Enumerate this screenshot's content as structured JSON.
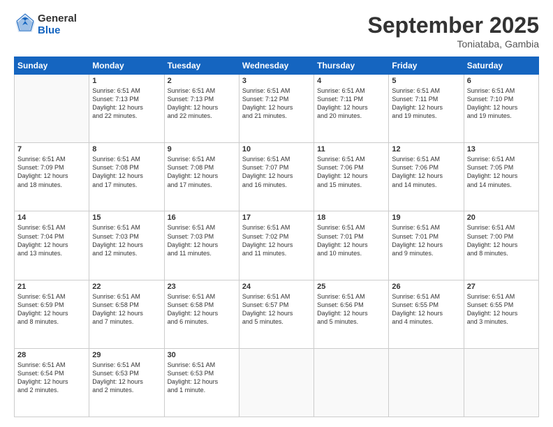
{
  "header": {
    "logo_line1": "General",
    "logo_line2": "Blue",
    "title": "September 2025",
    "subtitle": "Toniataba, Gambia"
  },
  "weekdays": [
    "Sunday",
    "Monday",
    "Tuesday",
    "Wednesday",
    "Thursday",
    "Friday",
    "Saturday"
  ],
  "weeks": [
    [
      {
        "day": "",
        "info": ""
      },
      {
        "day": "1",
        "info": "Sunrise: 6:51 AM\nSunset: 7:13 PM\nDaylight: 12 hours\nand 22 minutes."
      },
      {
        "day": "2",
        "info": "Sunrise: 6:51 AM\nSunset: 7:13 PM\nDaylight: 12 hours\nand 22 minutes."
      },
      {
        "day": "3",
        "info": "Sunrise: 6:51 AM\nSunset: 7:12 PM\nDaylight: 12 hours\nand 21 minutes."
      },
      {
        "day": "4",
        "info": "Sunrise: 6:51 AM\nSunset: 7:11 PM\nDaylight: 12 hours\nand 20 minutes."
      },
      {
        "day": "5",
        "info": "Sunrise: 6:51 AM\nSunset: 7:11 PM\nDaylight: 12 hours\nand 19 minutes."
      },
      {
        "day": "6",
        "info": "Sunrise: 6:51 AM\nSunset: 7:10 PM\nDaylight: 12 hours\nand 19 minutes."
      }
    ],
    [
      {
        "day": "7",
        "info": "Sunrise: 6:51 AM\nSunset: 7:09 PM\nDaylight: 12 hours\nand 18 minutes."
      },
      {
        "day": "8",
        "info": "Sunrise: 6:51 AM\nSunset: 7:08 PM\nDaylight: 12 hours\nand 17 minutes."
      },
      {
        "day": "9",
        "info": "Sunrise: 6:51 AM\nSunset: 7:08 PM\nDaylight: 12 hours\nand 17 minutes."
      },
      {
        "day": "10",
        "info": "Sunrise: 6:51 AM\nSunset: 7:07 PM\nDaylight: 12 hours\nand 16 minutes."
      },
      {
        "day": "11",
        "info": "Sunrise: 6:51 AM\nSunset: 7:06 PM\nDaylight: 12 hours\nand 15 minutes."
      },
      {
        "day": "12",
        "info": "Sunrise: 6:51 AM\nSunset: 7:06 PM\nDaylight: 12 hours\nand 14 minutes."
      },
      {
        "day": "13",
        "info": "Sunrise: 6:51 AM\nSunset: 7:05 PM\nDaylight: 12 hours\nand 14 minutes."
      }
    ],
    [
      {
        "day": "14",
        "info": "Sunrise: 6:51 AM\nSunset: 7:04 PM\nDaylight: 12 hours\nand 13 minutes."
      },
      {
        "day": "15",
        "info": "Sunrise: 6:51 AM\nSunset: 7:03 PM\nDaylight: 12 hours\nand 12 minutes."
      },
      {
        "day": "16",
        "info": "Sunrise: 6:51 AM\nSunset: 7:03 PM\nDaylight: 12 hours\nand 11 minutes."
      },
      {
        "day": "17",
        "info": "Sunrise: 6:51 AM\nSunset: 7:02 PM\nDaylight: 12 hours\nand 11 minutes."
      },
      {
        "day": "18",
        "info": "Sunrise: 6:51 AM\nSunset: 7:01 PM\nDaylight: 12 hours\nand 10 minutes."
      },
      {
        "day": "19",
        "info": "Sunrise: 6:51 AM\nSunset: 7:01 PM\nDaylight: 12 hours\nand 9 minutes."
      },
      {
        "day": "20",
        "info": "Sunrise: 6:51 AM\nSunset: 7:00 PM\nDaylight: 12 hours\nand 8 minutes."
      }
    ],
    [
      {
        "day": "21",
        "info": "Sunrise: 6:51 AM\nSunset: 6:59 PM\nDaylight: 12 hours\nand 8 minutes."
      },
      {
        "day": "22",
        "info": "Sunrise: 6:51 AM\nSunset: 6:58 PM\nDaylight: 12 hours\nand 7 minutes."
      },
      {
        "day": "23",
        "info": "Sunrise: 6:51 AM\nSunset: 6:58 PM\nDaylight: 12 hours\nand 6 minutes."
      },
      {
        "day": "24",
        "info": "Sunrise: 6:51 AM\nSunset: 6:57 PM\nDaylight: 12 hours\nand 5 minutes."
      },
      {
        "day": "25",
        "info": "Sunrise: 6:51 AM\nSunset: 6:56 PM\nDaylight: 12 hours\nand 5 minutes."
      },
      {
        "day": "26",
        "info": "Sunrise: 6:51 AM\nSunset: 6:55 PM\nDaylight: 12 hours\nand 4 minutes."
      },
      {
        "day": "27",
        "info": "Sunrise: 6:51 AM\nSunset: 6:55 PM\nDaylight: 12 hours\nand 3 minutes."
      }
    ],
    [
      {
        "day": "28",
        "info": "Sunrise: 6:51 AM\nSunset: 6:54 PM\nDaylight: 12 hours\nand 2 minutes."
      },
      {
        "day": "29",
        "info": "Sunrise: 6:51 AM\nSunset: 6:53 PM\nDaylight: 12 hours\nand 2 minutes."
      },
      {
        "day": "30",
        "info": "Sunrise: 6:51 AM\nSunset: 6:53 PM\nDaylight: 12 hours\nand 1 minute."
      },
      {
        "day": "",
        "info": ""
      },
      {
        "day": "",
        "info": ""
      },
      {
        "day": "",
        "info": ""
      },
      {
        "day": "",
        "info": ""
      }
    ]
  ]
}
